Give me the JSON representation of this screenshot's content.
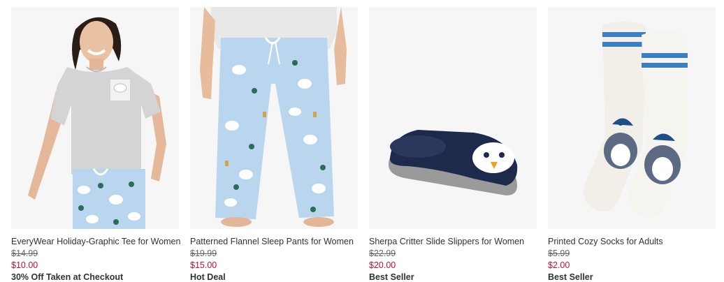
{
  "products": [
    {
      "image_alt": "woman wearing graphic tee and penguin print pajama pants",
      "name": "EveryWear Holiday-Graphic Tee for Women",
      "original_price": "$14.99",
      "sale_price": "$10.00",
      "promo": "30% Off Taken at Checkout"
    },
    {
      "image_alt": "light blue patterned flannel sleep pants",
      "name": "Patterned Flannel Sleep Pants for Women",
      "original_price": "$19.99",
      "sale_price": "$15.00",
      "promo": "Hot Deal"
    },
    {
      "image_alt": "navy sherpa penguin slide slipper",
      "name": "Sherpa Critter Slide Slippers for Women",
      "original_price": "$22.99",
      "sale_price": "$20.00",
      "promo": "Best Seller"
    },
    {
      "image_alt": "white cozy socks with blue stripes and penguins",
      "name": "Printed Cozy Socks for Adults",
      "original_price": "$5.99",
      "sale_price": "$2.00",
      "promo": "Best Seller"
    }
  ],
  "colors": {
    "sale_red": "#c8102e",
    "text_dark": "#333333",
    "text_muted": "#666666",
    "pajama_blue": "#b9d6ee",
    "navy": "#1d2a4c",
    "stripe_blue": "#3a7ec3"
  }
}
